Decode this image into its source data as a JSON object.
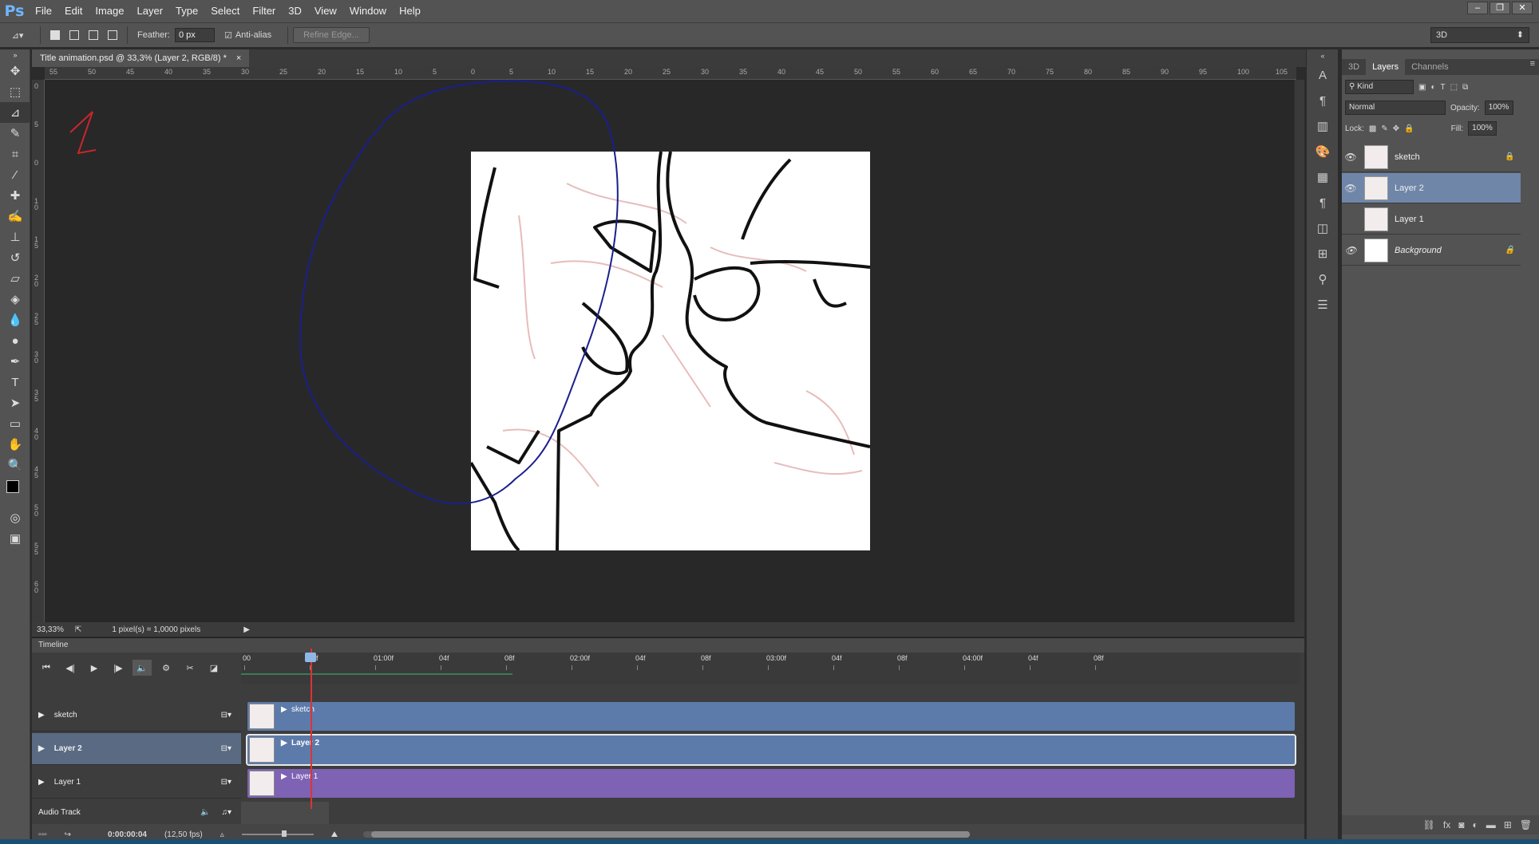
{
  "app": {
    "logo": "Ps"
  },
  "menu": [
    "File",
    "Edit",
    "Image",
    "Layer",
    "Type",
    "Select",
    "Filter",
    "3D",
    "View",
    "Window",
    "Help"
  ],
  "options": {
    "feather_label": "Feather:",
    "feather_value": "0 px",
    "antialias_label": "Anti-alias",
    "refine_edge": "Refine Edge...",
    "workspace": "3D"
  },
  "document": {
    "tab_title": "Title animation.psd @ 33,3% (Layer 2, RGB/8) *",
    "close": "×",
    "zoom": "33,33%",
    "pixel_info": "1 pixel(s) = 1,0000 pixels"
  },
  "ruler_h": [
    "55",
    "50",
    "45",
    "40",
    "35",
    "30",
    "25",
    "20",
    "15",
    "10",
    "5",
    "0",
    "5",
    "10",
    "15",
    "20",
    "25",
    "30",
    "35",
    "40",
    "45",
    "50",
    "55",
    "60",
    "65",
    "70",
    "75",
    "80",
    "85",
    "90",
    "95",
    "100",
    "105"
  ],
  "ruler_v": [
    "0",
    "5",
    "0",
    "1 0",
    "1 5",
    "2 0",
    "2 5",
    "3 0",
    "3 5",
    "4 0",
    "4 5",
    "5 0",
    "5 5",
    "6 0"
  ],
  "timeline": {
    "title": "Timeline",
    "ticks": [
      "00",
      "08f",
      "01:00f",
      "04f",
      "08f",
      "02:00f",
      "04f",
      "08f",
      "03:00f",
      "04f",
      "08f",
      "04:00f",
      "04f",
      "08f"
    ],
    "tracks": [
      {
        "name": "sketch",
        "clip": "sketch",
        "color": "#5c7bab"
      },
      {
        "name": "Layer 2",
        "clip": "Layer 2",
        "color": "#5c7bab"
      },
      {
        "name": "Layer 1",
        "clip": "Layer 1",
        "color": "#7e62b4"
      }
    ],
    "audio_track": "Audio Track",
    "timecode": "0:00:00:04",
    "fps": "(12,50 fps)"
  },
  "layers_panel": {
    "tabs": [
      "3D",
      "Layers",
      "Channels"
    ],
    "kind": "Kind",
    "blend_mode": "Normal",
    "opacity_label": "Opacity:",
    "opacity": "100%",
    "lock_label": "Lock:",
    "fill_label": "Fill:",
    "fill": "100%",
    "layers": [
      {
        "name": "sketch",
        "visible": true,
        "locked": true
      },
      {
        "name": "Layer 2",
        "visible": true,
        "locked": false,
        "selected": true
      },
      {
        "name": "Layer 1",
        "visible": false,
        "locked": false
      },
      {
        "name": "Background",
        "visible": true,
        "locked": true
      }
    ]
  },
  "colors": {
    "accent_selection": "#6f86a8",
    "clip_blue": "#5c7bab",
    "clip_purple": "#7e62b4",
    "playhead": "#d33333",
    "lasso_stroke": "#1a1f8c"
  }
}
